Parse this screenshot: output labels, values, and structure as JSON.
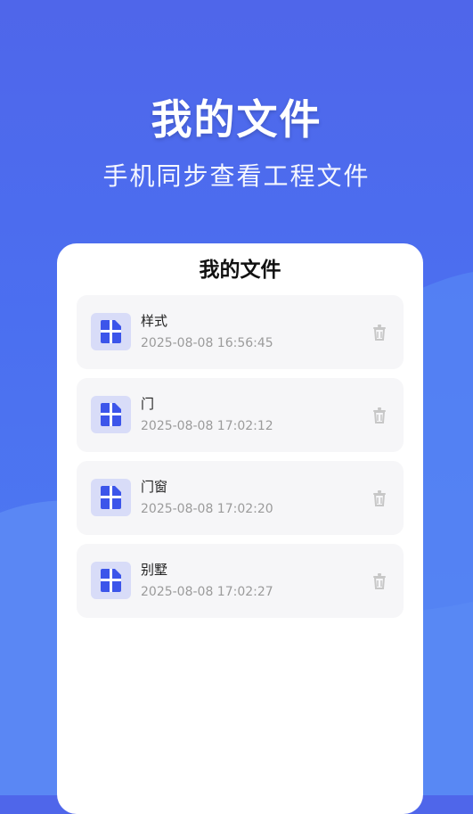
{
  "hero": {
    "title": "我的文件",
    "subtitle": "手机同步查看工程文件"
  },
  "card": {
    "title": "我的文件"
  },
  "files": [
    {
      "name": "样式",
      "time": "2025-08-08 16:56:45"
    },
    {
      "name": "门",
      "time": "2025-08-08 17:02:12"
    },
    {
      "name": "门窗",
      "time": "2025-08-08 17:02:20"
    },
    {
      "name": "别墅",
      "time": "2025-08-08 17:02:27"
    }
  ],
  "icons": {
    "file": "blueprint-file-icon",
    "delete": "trash-icon"
  },
  "colors": {
    "background_primary": "#4f66ea",
    "card_background": "#ffffff",
    "item_background": "#f6f6f8",
    "icon_background": "#d8dcf8",
    "icon_accent": "#3c55ea",
    "delete_icon": "#c7c7c7",
    "time_text": "#9b9b9b"
  }
}
